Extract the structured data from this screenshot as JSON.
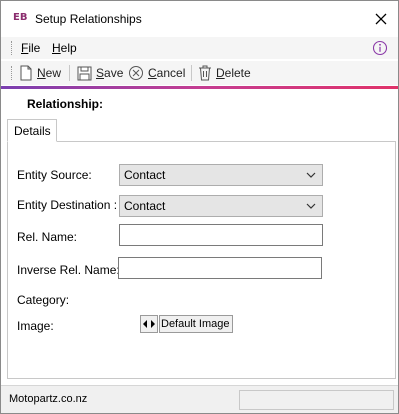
{
  "window": {
    "logo_text": "EB",
    "title": "Setup Relationships"
  },
  "menu": {
    "file": {
      "accel": "F",
      "rest": "ile"
    },
    "help": {
      "accel": "H",
      "rest": "elp"
    }
  },
  "toolbar": {
    "new": {
      "accel": "N",
      "rest": "ew"
    },
    "save": {
      "accel": "S",
      "rest": "ave"
    },
    "cancel": {
      "accel": "C",
      "rest": "ancel"
    },
    "delete": {
      "accel": "D",
      "rest": "elete"
    }
  },
  "heading": "Relationship:",
  "tabs": [
    {
      "label": "Details"
    }
  ],
  "form": {
    "entity_source": {
      "label": "Entity Source:",
      "value": "Contact"
    },
    "entity_destination": {
      "label": "Entity Destination :",
      "value": "Contact"
    },
    "rel_name": {
      "label": "Rel. Name:",
      "value": ""
    },
    "inverse_rel_name": {
      "label": "Inverse Rel. Name:",
      "value": ""
    },
    "category": {
      "label": "Category:"
    },
    "image": {
      "label": "Image:",
      "button": "Default Image"
    }
  },
  "status": {
    "text": "Motopartz.co.nz"
  },
  "icons": {
    "close": "close-icon",
    "info": "info-icon",
    "new": "new-document-icon",
    "save": "save-icon",
    "cancel": "cancel-icon",
    "delete": "delete-icon"
  },
  "colors": {
    "logo": "#8b2d6e",
    "accent_start": "#7a3fb0",
    "accent_end": "#e0336a",
    "info_icon": "#8b3aa8"
  }
}
